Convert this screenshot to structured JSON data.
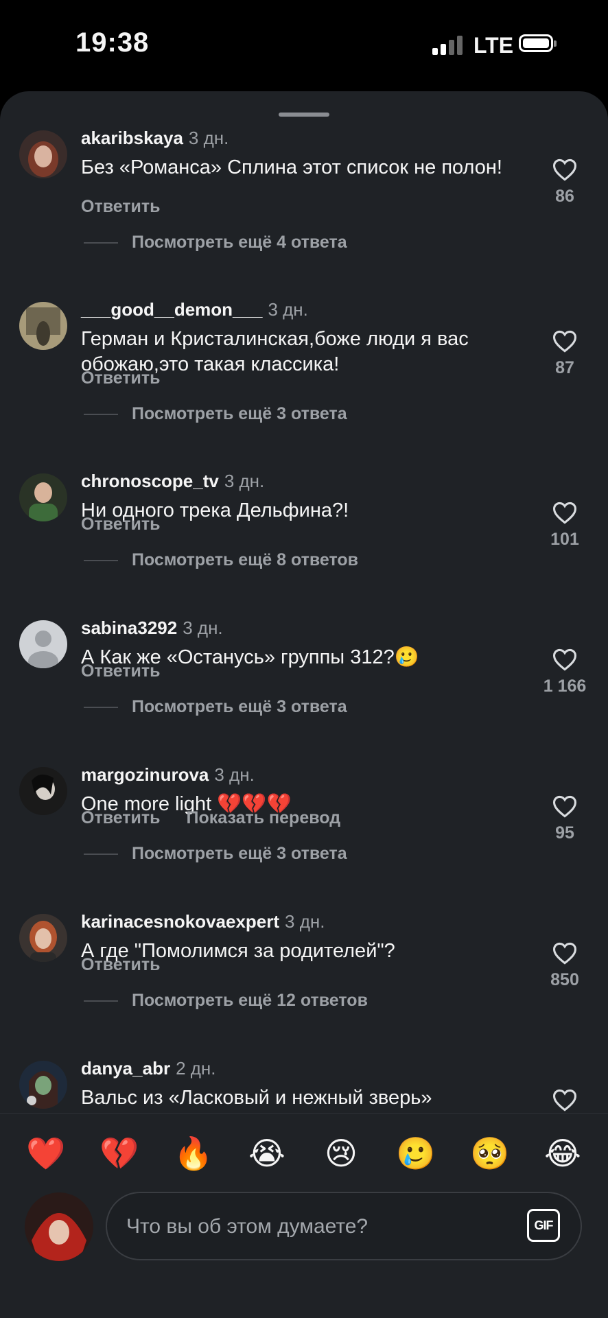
{
  "status": {
    "time": "19:38",
    "network": "LTE"
  },
  "comments": [
    {
      "user": "akaribskaya",
      "when": "3 дн.",
      "text": "Без «Романса» Сплина этот список не полон!",
      "reply": "Ответить",
      "likes": "86",
      "replies": "Посмотреть ещё 4 ответа",
      "avatar_color": "#6b3a2e"
    },
    {
      "user": "___good__demon___",
      "when": "3 дн.",
      "text": "Герман и Кристалинская,боже люди я вас обожаю,это такая классика!",
      "reply": "Ответить",
      "likes": "87",
      "replies": "Посмотреть ещё 3 ответа",
      "avatar_color": "#8a7a55"
    },
    {
      "user": "chronoscope_tv",
      "when": "3 дн.",
      "text": "Ни одного трека Дельфина?!",
      "reply": "Ответить",
      "likes": "101",
      "replies": "Посмотреть ещё 8 ответов",
      "avatar_color": "#3d4a3a"
    },
    {
      "user": "sabina3292",
      "when": "3 дн.",
      "text": "А Как же «Останусь» группы 312?🥲",
      "reply": "Ответить",
      "likes": "1 166",
      "replies": "Посмотреть ещё 3 ответа",
      "avatar_color": "#cfd2d6"
    },
    {
      "user": "margozinurova",
      "when": "3 дн.",
      "text": "One more light 💔💔💔",
      "reply": "Ответить",
      "translate": "Показать перевод",
      "likes": "95",
      "replies": "Посмотреть ещё 3 ответа",
      "avatar_color": "#2b2b2b"
    },
    {
      "user": "karinacesnokovaexpert",
      "when": "3 дн.",
      "text": "А где \"Помолимся за родителей\"?",
      "reply": "Ответить",
      "likes": "850",
      "replies": "Посмотреть ещё 12 ответов",
      "avatar_color": "#a0523a"
    },
    {
      "user": "danya_abr",
      "when": "2 дн.",
      "text": "Вальс из «Ласковый и нежный зверь»",
      "avatar_color": "#2c3d55"
    }
  ],
  "emojis": [
    "❤️",
    "💔",
    "🔥",
    "😭",
    "😢",
    "🥲",
    "🥺",
    "😂"
  ],
  "composer": {
    "placeholder": "Что вы об этом думаете?",
    "gif_label": "GIF"
  },
  "icons": {
    "like": "heart-outline-icon",
    "gif": "gif-icon"
  }
}
